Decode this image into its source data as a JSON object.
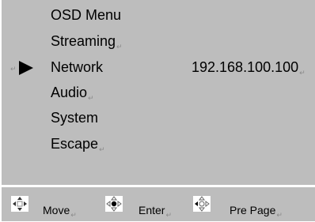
{
  "menu": {
    "items": [
      {
        "label": "OSD Menu",
        "mark": ""
      },
      {
        "label": "Streaming",
        "mark": "↵"
      },
      {
        "label": "Network",
        "mark": ""
      },
      {
        "label": "Audio",
        "mark": "↵"
      },
      {
        "label": "System",
        "mark": ""
      },
      {
        "label": "Escape",
        "mark": "↵"
      }
    ],
    "selected_mark": "↵",
    "network_value": "192.168.100.100",
    "network_value_mark": "↵"
  },
  "footer": {
    "move_label": "Move",
    "move_mark": "↵",
    "enter_label": "Enter",
    "enter_mark": "↵",
    "prepage_label": "Pre Page",
    "prepage_mark": "↵"
  },
  "colors": {
    "panel": "#bdbdbd",
    "text": "#000000",
    "icon_bg": "#ffffff"
  },
  "icons": {
    "selection": "right-triangle-icon",
    "move": "four-way-arrows-icon",
    "enter": "enter-dpad-icon",
    "prepage": "left-dpad-icon"
  }
}
